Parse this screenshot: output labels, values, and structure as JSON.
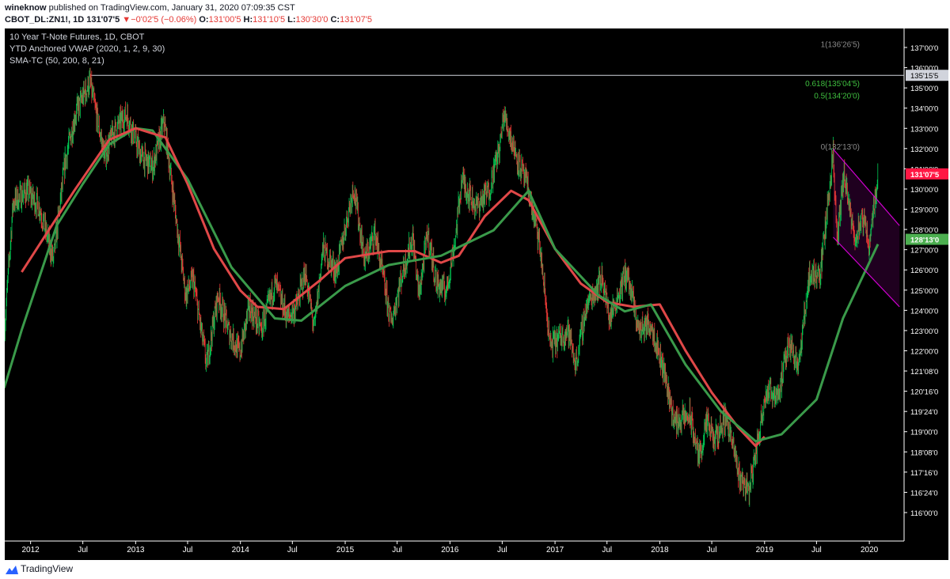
{
  "header": {
    "author": "wineknow",
    "published_text": "published on TradingView.com, January 31, 2020 07:09:35 CST",
    "symbol": "CBOT_DL:ZN1!, 1D",
    "last": "131'07'5",
    "change_arrow": "▼",
    "change": "−0'02'5 (−0.06%)",
    "o_label": "O:",
    "o_value": "131'00'5",
    "h_label": "H:",
    "h_value": "131'10'5",
    "l_label": "L:",
    "l_value": "130'30'0",
    "c_label": "C:",
    "c_value": "131'07'5"
  },
  "legend": {
    "title": "10 Year T-Note Futures, 1D, CBOT",
    "indicator1": "YTD Anchored VWAP (2020, 1, 2, 9, 30)",
    "indicator2": "SMA-TC (50, 200, 8, 21)"
  },
  "footer": {
    "brand": "TradingView"
  },
  "colors": {
    "background": "#000000",
    "up": "#00c853",
    "down": "#e53935",
    "sma_fast": "#e04848",
    "sma_slow": "#3a9a4a",
    "channel": "#d100d1",
    "fib_green": "#3fbf3f",
    "fib_gray": "#8a8a8a",
    "price_badge": "#ff1744",
    "sma_badge": "#4caf50"
  },
  "chart_data": {
    "type": "candlestick",
    "title": "10 Year T-Note Futures, 1D, CBOT",
    "x_axis_labels": [
      "2012",
      "Jul",
      "2013",
      "Jul",
      "2014",
      "Jul",
      "2015",
      "Jul",
      "2016",
      "Jul",
      "2017",
      "Jul",
      "2018",
      "Jul",
      "2019",
      "Jul",
      "2020"
    ],
    "y_axis_labels": [
      "137'00'0",
      "136'00'0",
      "135'00'0",
      "134'00'0",
      "133'00'0",
      "132'00'0",
      "131'00'0",
      "130'00'0",
      "129'00'0",
      "128'00'0",
      "127'00'0",
      "126'00'0",
      "125'00'0",
      "124'00'0",
      "123'00'0",
      "122'00'0",
      "121'08'0",
      "120'16'0",
      "119'24'0",
      "119'00'0",
      "118'08'0",
      "117'16'0",
      "116'24'0",
      "116'00'0"
    ],
    "y_range": [
      115.4,
      137.5
    ],
    "price_path": [
      [
        "2011-10-03",
        124.7
      ],
      [
        "2011-11-01",
        130.0
      ],
      [
        "2011-12-20",
        130.5
      ],
      [
        "2012-02-01",
        129.8
      ],
      [
        "2012-03-20",
        127.5
      ],
      [
        "2012-05-01",
        131.8
      ],
      [
        "2012-06-05",
        133.8
      ],
      [
        "2012-07-25",
        135.2
      ],
      [
        "2012-09-15",
        132.0
      ],
      [
        "2012-10-15",
        133.0
      ],
      [
        "2012-12-01",
        133.8
      ],
      [
        "2013-01-20",
        132.0
      ],
      [
        "2013-03-01",
        131.5
      ],
      [
        "2013-04-10",
        133.5
      ],
      [
        "2013-05-10",
        130.5
      ],
      [
        "2013-06-24",
        126.0
      ],
      [
        "2013-07-20",
        126.7
      ],
      [
        "2013-09-05",
        123.0
      ],
      [
        "2013-10-15",
        126.0
      ],
      [
        "2013-11-20",
        124.5
      ],
      [
        "2013-12-30",
        123.5
      ],
      [
        "2014-02-01",
        125.5
      ],
      [
        "2014-03-15",
        124.5
      ],
      [
        "2014-05-01",
        126.5
      ],
      [
        "2014-06-15",
        125.0
      ],
      [
        "2014-07-15",
        125.5
      ],
      [
        "2014-08-15",
        127.0
      ],
      [
        "2014-09-15",
        124.5
      ],
      [
        "2014-10-15",
        128.0
      ],
      [
        "2014-12-01",
        127.0
      ],
      [
        "2015-01-30",
        130.7
      ],
      [
        "2015-03-10",
        127.5
      ],
      [
        "2015-04-15",
        128.7
      ],
      [
        "2015-06-10",
        124.8
      ],
      [
        "2015-07-20",
        127.0
      ],
      [
        "2015-08-24",
        128.5
      ],
      [
        "2015-09-15",
        126.0
      ],
      [
        "2015-10-15",
        128.7
      ],
      [
        "2015-11-15",
        126.5
      ],
      [
        "2015-12-20",
        126.2
      ],
      [
        "2016-01-20",
        128.5
      ],
      [
        "2016-02-11",
        131.0
      ],
      [
        "2016-04-01",
        129.8
      ],
      [
        "2016-05-15",
        130.5
      ],
      [
        "2016-06-24",
        132.5
      ],
      [
        "2016-07-06",
        133.8
      ],
      [
        "2016-08-20",
        132.0
      ],
      [
        "2016-10-01",
        130.5
      ],
      [
        "2016-11-10",
        128.0
      ],
      [
        "2016-12-15",
        123.8
      ],
      [
        "2017-02-15",
        124.5
      ],
      [
        "2017-03-14",
        123.0
      ],
      [
        "2017-04-20",
        125.5
      ],
      [
        "2017-06-14",
        126.8
      ],
      [
        "2017-07-10",
        125.0
      ],
      [
        "2017-09-07",
        127.0
      ],
      [
        "2017-10-20",
        124.5
      ],
      [
        "2017-12-01",
        124.8
      ],
      [
        "2018-01-20",
        122.5
      ],
      [
        "2018-02-21",
        120.5
      ],
      [
        "2018-04-15",
        120.8
      ],
      [
        "2018-05-17",
        119.0
      ],
      [
        "2018-06-15",
        120.5
      ],
      [
        "2018-07-10",
        119.7
      ],
      [
        "2018-08-20",
        120.8
      ],
      [
        "2018-10-05",
        118.2
      ],
      [
        "2018-11-08",
        117.6
      ],
      [
        "2018-12-10",
        119.8
      ],
      [
        "2019-01-03",
        121.8
      ],
      [
        "2019-02-20",
        121.8
      ],
      [
        "2019-03-28",
        124.0
      ],
      [
        "2019-05-01",
        123.0
      ],
      [
        "2019-06-04",
        126.8
      ],
      [
        "2019-07-15",
        127.0
      ],
      [
        "2019-08-28",
        132.2
      ],
      [
        "2019-09-10",
        128.2
      ],
      [
        "2019-10-04",
        131.2
      ],
      [
        "2019-11-08",
        128.5
      ],
      [
        "2019-12-13",
        129.2
      ],
      [
        "2019-12-31",
        128.2
      ],
      [
        "2020-01-31",
        131.2
      ]
    ],
    "sma_fast": [
      [
        "2011-12-01",
        127.0
      ],
      [
        "2012-06-01",
        130.5
      ],
      [
        "2012-10-01",
        132.7
      ],
      [
        "2013-01-01",
        133.2
      ],
      [
        "2013-04-15",
        132.8
      ],
      [
        "2013-07-01",
        130.8
      ],
      [
        "2013-10-01",
        128.0
      ],
      [
        "2014-01-01",
        126.2
      ],
      [
        "2014-03-01",
        125.5
      ],
      [
        "2014-06-01",
        125.4
      ],
      [
        "2014-10-01",
        126.6
      ],
      [
        "2015-01-01",
        127.6
      ],
      [
        "2015-06-01",
        127.9
      ],
      [
        "2015-09-01",
        127.9
      ],
      [
        "2015-12-01",
        127.4
      ],
      [
        "2016-02-01",
        127.7
      ],
      [
        "2016-05-01",
        129.4
      ],
      [
        "2016-08-01",
        130.5
      ],
      [
        "2016-10-01",
        130.1
      ],
      [
        "2017-01-01",
        128.0
      ],
      [
        "2017-04-01",
        126.5
      ],
      [
        "2017-07-01",
        125.7
      ],
      [
        "2017-10-01",
        125.5
      ],
      [
        "2018-01-01",
        125.6
      ],
      [
        "2018-04-01",
        123.6
      ],
      [
        "2018-07-01",
        121.8
      ],
      [
        "2018-10-01",
        120.3
      ],
      [
        "2018-12-01",
        119.5
      ],
      [
        "2019-01-01",
        119.9
      ]
    ],
    "sma_slow": [
      [
        "2011-10-01",
        122.0
      ],
      [
        "2011-12-01",
        124.5
      ],
      [
        "2012-04-01",
        129.0
      ],
      [
        "2012-07-01",
        130.8
      ],
      [
        "2012-10-01",
        132.5
      ],
      [
        "2013-01-01",
        133.2
      ],
      [
        "2013-03-01",
        133.1
      ],
      [
        "2013-07-01",
        131.0
      ]
    ],
    "sma_slow_late": [
      [
        "2013-07-01",
        131.0
      ],
      [
        "2013-12-01",
        127.2
      ],
      [
        "2014-05-01",
        125.0
      ],
      [
        "2014-08-01",
        124.9
      ],
      [
        "2015-01-01",
        126.4
      ],
      [
        "2015-06-01",
        127.3
      ],
      [
        "2015-12-01",
        127.7
      ],
      [
        "2016-06-01",
        128.8
      ],
      [
        "2016-10-01",
        130.5
      ],
      [
        "2017-01-01",
        128.0
      ],
      [
        "2017-06-01",
        126.0
      ],
      [
        "2017-09-01",
        125.3
      ],
      [
        "2017-12-01",
        125.6
      ],
      [
        "2018-04-01",
        123.0
      ],
      [
        "2018-08-01",
        121.0
      ],
      [
        "2018-12-01",
        119.7
      ],
      [
        "2019-03-01",
        120.0
      ],
      [
        "2019-07-01",
        121.5
      ],
      [
        "2019-10-01",
        125.0
      ],
      [
        "2020-01-31",
        128.2
      ]
    ],
    "fib_levels": [
      {
        "label": "1(136'26'5)",
        "value": 136.83
      },
      {
        "label": "0.618(135'04'5)",
        "value": 135.14
      },
      {
        "label": "0.5(134'20'0)",
        "value": 134.62
      },
      {
        "label": "0(132'13'0)",
        "value": 132.41
      }
    ],
    "horizontal_line": {
      "label": "135'15'5",
      "value": 135.48,
      "from": "2012-07-25"
    },
    "price_badges": [
      {
        "label": "131'07'5",
        "value": 131.23,
        "kind": "last"
      },
      {
        "label": "128'13'0",
        "value": 128.41,
        "kind": "sma"
      }
    ],
    "channel": {
      "upper": [
        [
          "2019-08-28",
          132.3
        ],
        [
          "2020-04-15",
          129.0
        ]
      ],
      "lower": [
        [
          "2019-08-28",
          128.5
        ],
        [
          "2020-04-15",
          125.5
        ]
      ]
    }
  }
}
